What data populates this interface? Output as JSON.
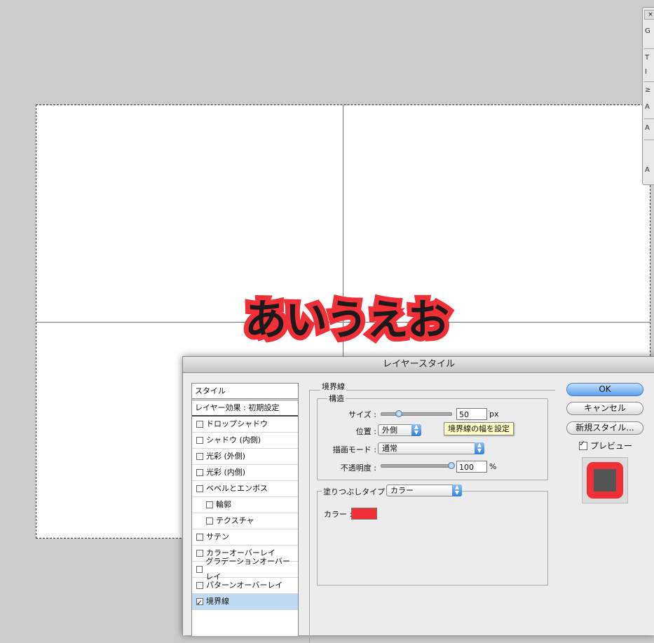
{
  "canvas": {
    "sample_text": "あいうえお"
  },
  "tool_palette": {
    "close": "×",
    "tools": [
      "G",
      "T",
      "I",
      "≥",
      "A",
      "A",
      "A"
    ]
  },
  "dialog": {
    "title": "レイヤースタイル",
    "style_list": {
      "header": "スタイル",
      "blend_header": "レイヤー効果 : 初期設定",
      "items": [
        {
          "label": "ドロップシャドウ",
          "checked": false
        },
        {
          "label": "シャドウ (内側)",
          "checked": false
        },
        {
          "label": "光彩 (外側)",
          "checked": false
        },
        {
          "label": "光彩 (内側)",
          "checked": false
        },
        {
          "label": "ベベルとエンボス",
          "checked": false
        },
        {
          "label": "輪郭",
          "checked": false
        },
        {
          "label": "テクスチャ",
          "checked": false
        },
        {
          "label": "サテン",
          "checked": false
        },
        {
          "label": "カラーオーバーレイ",
          "checked": false
        },
        {
          "label": "グラデーションオーバーレイ",
          "checked": false
        },
        {
          "label": "パターンオーバーレイ",
          "checked": false
        },
        {
          "label": "境界線",
          "checked": true
        }
      ]
    },
    "stroke": {
      "group_title": "境界線",
      "structure_title": "構造",
      "size_label": "サイズ :",
      "size_value": "50",
      "size_unit": "px",
      "size_slider_fraction": 0.25,
      "tooltip": "境界線の幅を設定",
      "position_label": "位置 :",
      "position_value": "外側",
      "blend_label": "描画モード :",
      "blend_value": "通常",
      "opacity_label": "不透明度 :",
      "opacity_value": "100",
      "opacity_unit": "%",
      "opacity_slider_fraction": 1.0,
      "fill_type_label": "塗りつぶしタイプ :",
      "fill_type_value": "カラー",
      "color_label": "カラー :",
      "color_hex": "#f03036"
    },
    "buttons": {
      "ok": "OK",
      "cancel": "キャンセル",
      "new_style": "新規スタイル...",
      "preview": "プレビュー",
      "preview_checked": true
    }
  }
}
